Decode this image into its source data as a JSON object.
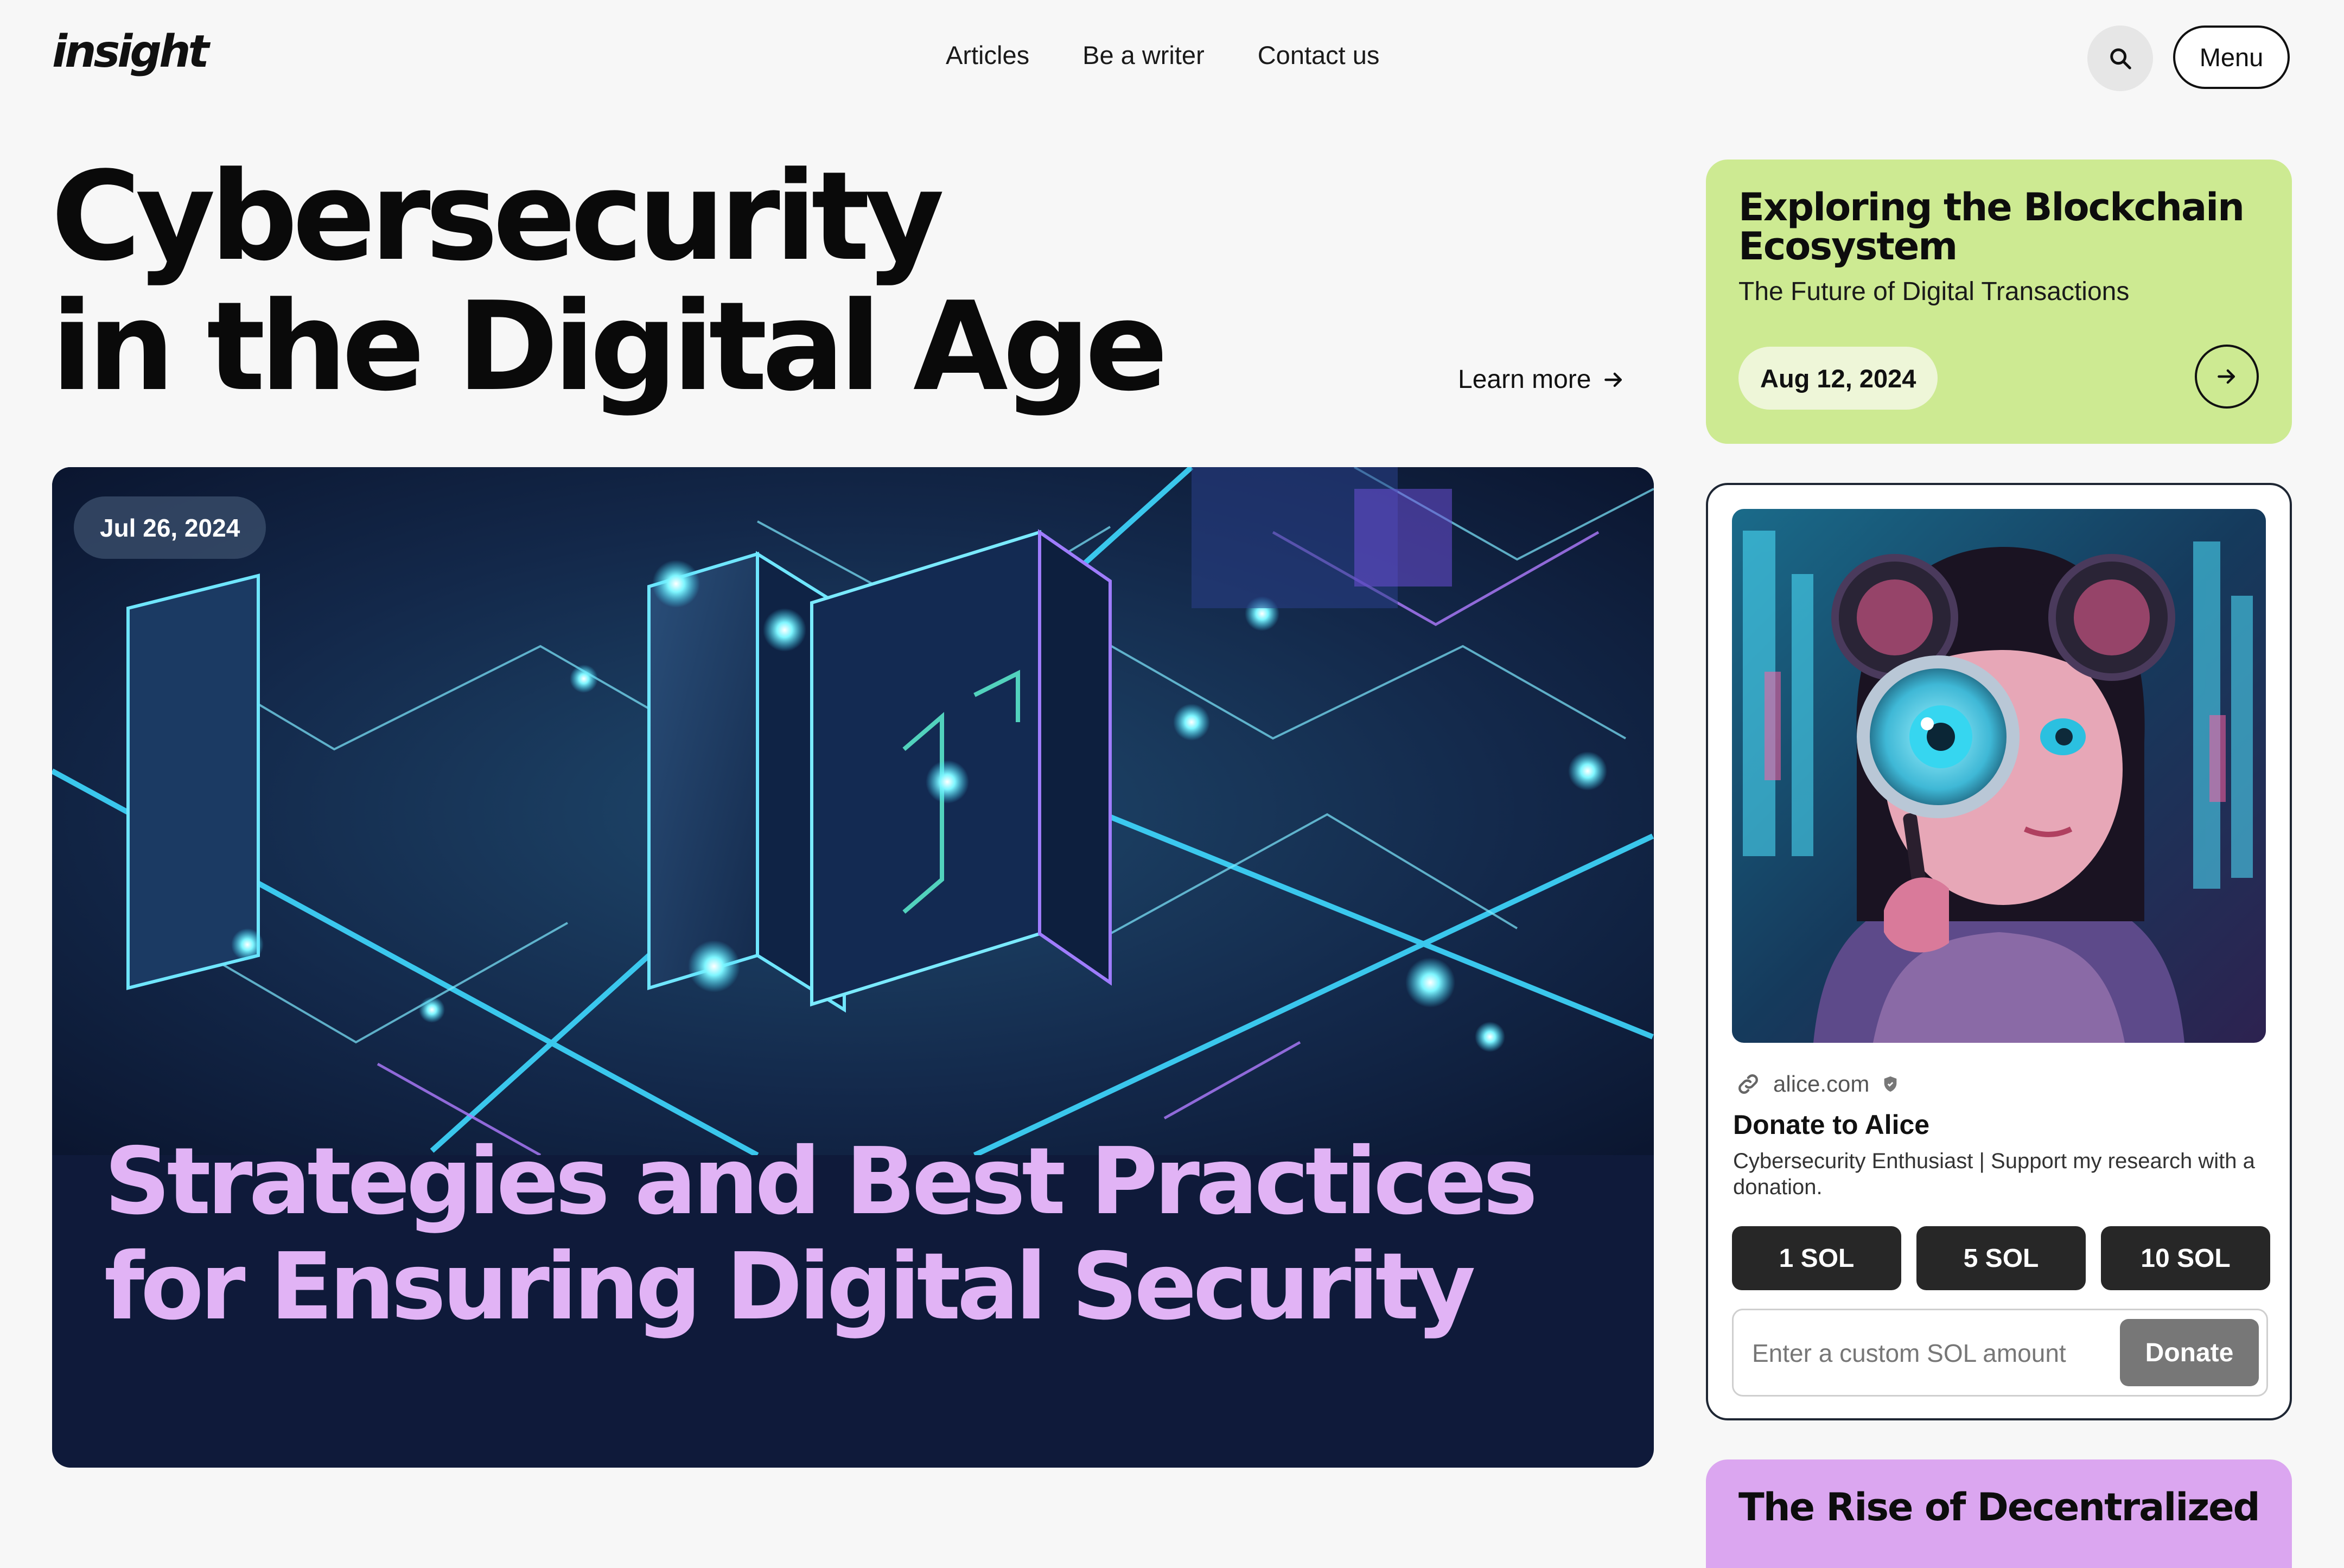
{
  "header": {
    "logo": "insight",
    "nav": [
      "Articles",
      "Be a writer",
      "Contact us"
    ],
    "search_icon": "search-icon",
    "menu_label": "Menu"
  },
  "hero": {
    "title_line1": "Cybersecurity",
    "title_line2": "in the Digital Age",
    "learn_more": "Learn more",
    "learn_more_icon": "arrow-right-icon"
  },
  "feature": {
    "date": "Jul 26, 2024",
    "title_line1": "Strategies and Best Practices",
    "title_line2": "for Ensuring Digital Security"
  },
  "green_card": {
    "title_line1": "Exploring the Blockchain",
    "title_line2": "Ecosystem",
    "subtitle": "The Future of Digital Transactions",
    "date": "Aug 12, 2024",
    "arrow_icon": "arrow-right-icon",
    "color": "#cdea92"
  },
  "donate_card": {
    "site": "alice.com",
    "link_icon": "link-icon",
    "verified_icon": "shield-icon",
    "title": "Donate to Alice",
    "description": "Cybersecurity Enthusiast | Support my research with a donation.",
    "amounts": [
      "1 SOL",
      "5 SOL",
      "10 SOL"
    ],
    "custom_placeholder": "Enter a custom SOL amount",
    "donate_label": "Donate"
  },
  "purple_card": {
    "title": "The Rise of Decentralized",
    "color": "#dba6f0"
  }
}
